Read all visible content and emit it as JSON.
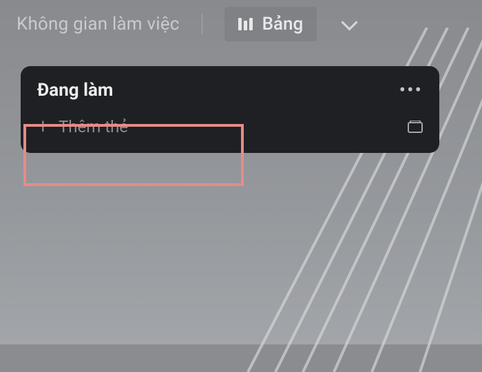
{
  "header": {
    "workspace_partial_label": "Không gian làm việc",
    "board_view_label": "Bảng"
  },
  "list": {
    "title": "Đang làm",
    "add_card_label": "Thêm thẻ"
  },
  "colors": {
    "card_bg": "#1f2023",
    "highlight": "#e88b87"
  }
}
